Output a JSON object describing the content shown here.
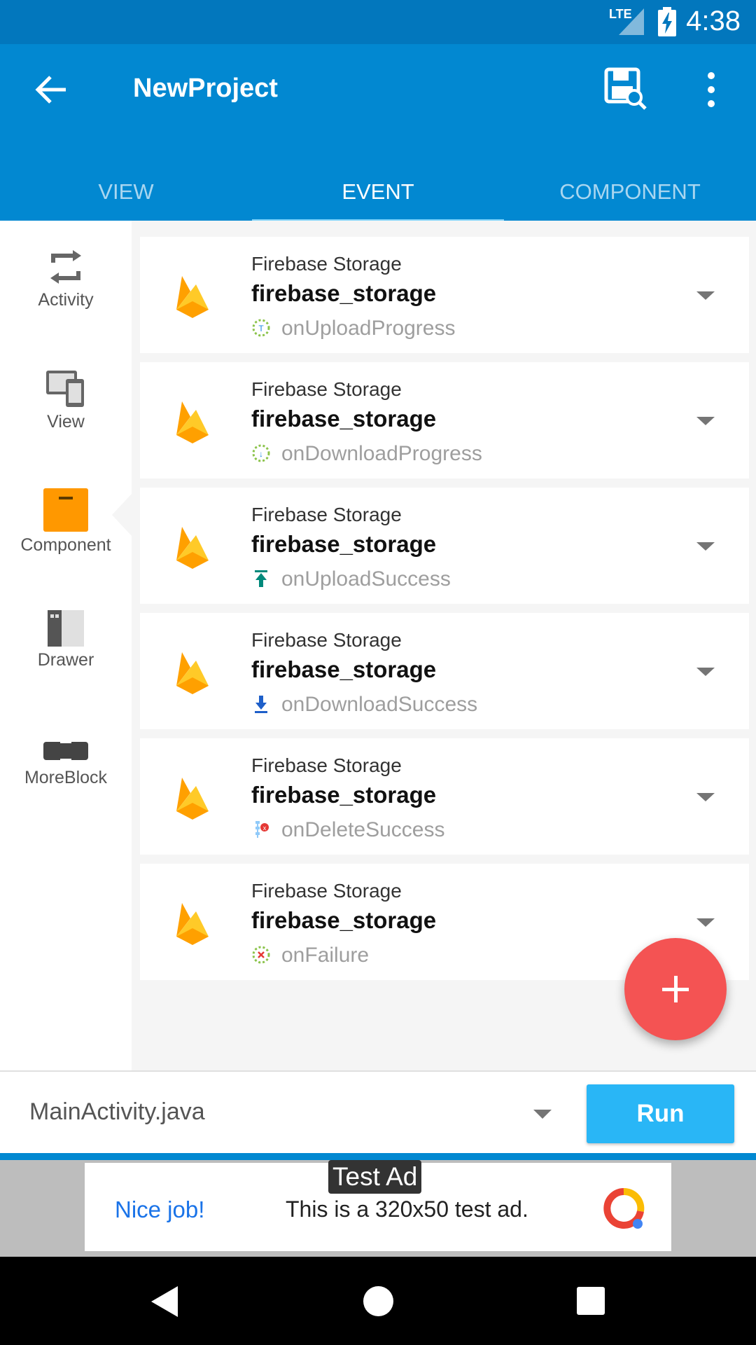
{
  "status_bar": {
    "network": "LTE",
    "time": "4:38"
  },
  "app_bar": {
    "title": "NewProject"
  },
  "tabs": [
    {
      "label": "VIEW",
      "active": false
    },
    {
      "label": "EVENT",
      "active": true
    },
    {
      "label": "COMPONENT",
      "active": false
    }
  ],
  "sidebar": {
    "items": [
      {
        "label": "Activity",
        "icon": "activity-icon"
      },
      {
        "label": "View",
        "icon": "view-icon"
      },
      {
        "label": "Component",
        "icon": "component-icon",
        "selected": true
      },
      {
        "label": "Drawer",
        "icon": "drawer-icon"
      },
      {
        "label": "MoreBlock",
        "icon": "moreblock-icon"
      }
    ]
  },
  "events": [
    {
      "type": "Firebase Storage",
      "name": "firebase_storage",
      "event": "onUploadProgress",
      "icon": "upload-progress-icon"
    },
    {
      "type": "Firebase Storage",
      "name": "firebase_storage",
      "event": "onDownloadProgress",
      "icon": "download-progress-icon"
    },
    {
      "type": "Firebase Storage",
      "name": "firebase_storage",
      "event": "onUploadSuccess",
      "icon": "upload-success-icon"
    },
    {
      "type": "Firebase Storage",
      "name": "firebase_storage",
      "event": "onDownloadSuccess",
      "icon": "download-success-icon"
    },
    {
      "type": "Firebase Storage",
      "name": "firebase_storage",
      "event": "onDeleteSuccess",
      "icon": "delete-success-icon"
    },
    {
      "type": "Firebase Storage",
      "name": "firebase_storage",
      "event": "onFailure",
      "icon": "failure-icon"
    }
  ],
  "bottom_bar": {
    "file": "MainActivity.java",
    "run_label": "Run"
  },
  "ad": {
    "label": "Test Ad",
    "nice": "Nice job!",
    "text": "This is a 320x50 test ad."
  },
  "colors": {
    "primary": "#0288d1",
    "status_bar": "#0277bd",
    "fab": "#f45353",
    "run": "#29b6f6",
    "component": "#ff9800"
  }
}
